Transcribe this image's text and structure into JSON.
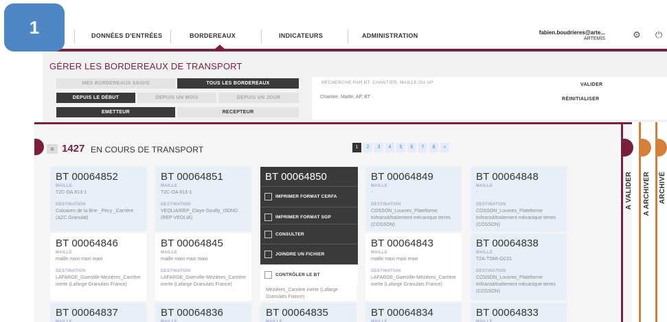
{
  "step_number": "1",
  "nav": {
    "items": [
      "DONNÉES D'ENTRÉES",
      "BORDEREAUX",
      "INDICATEURS",
      "ADMINISTRATION"
    ]
  },
  "user": {
    "name": "fabien.boudrieres@arte...",
    "org": "ARTEMIS"
  },
  "panel": {
    "title": "GÉRER LES BORDEREAUX DE TRANSPORT",
    "scope": [
      "MES BORDEREAUX SAISIS",
      "TOUS LES BORDEREAUX"
    ],
    "period": [
      "DEPUIS LE DÉBUT",
      "DEPUIS UN MOIS",
      "DEPUIS UN JOUR"
    ],
    "role": [
      "EMETTEUR",
      "RECEPTEUR"
    ],
    "search_label": "RECHERCHE PAR BT, CHANTIER, MAILLE OU AP",
    "search_placeholder": "Chantier, Maille, AP, BT",
    "validate": "VALIDER",
    "reset": "RÉINITIALISER"
  },
  "list": {
    "count": "1427",
    "label": "EN COURS DE TRANSPORT",
    "pages": [
      "1",
      "2",
      "3",
      "4",
      "5",
      "6",
      "7",
      "8",
      "»"
    ]
  },
  "labels": {
    "maille": "MAILLE",
    "destination": "DESTINATION"
  },
  "cards": [
    {
      "id": "BT 00064852",
      "maille": "T2C-OA 813-1",
      "dest": "Calcaires de la Brie _Pécy _Carrière (AZC Granulat)"
    },
    {
      "id": "BT 00064851",
      "maille": "T2C-OA 813-1",
      "dest": "VEOLIA/REP_Claye-Souilly_ISDND (REP VEOLIA)"
    },
    {
      "id": "BT 00064849",
      "maille": "-",
      "dest": "COSSON_Louvres_Plateforme tri/transit/traitement mécanique terres (COSSON)"
    },
    {
      "id": "BT 00064848",
      "maille": "-",
      "dest": "COSSON_Louvres_Plateforme tri/transit/traitement mécanique terres (COSSON)"
    },
    {
      "id": "BT 00064846",
      "maille": "maille maxi maxi maxi",
      "dest": "LAFARGE_Guerville-Mézières_Carrière inerte (Lafarge Granulats France)"
    },
    {
      "id": "BT 00064845",
      "maille": "maille maxi maxi maxi",
      "dest": "LAFARGE_Guerville-Mézières_Carrière inerte (Lafarge Granulats France)"
    },
    {
      "id": "BT 00064843",
      "maille": "maille maxi maxi maxi",
      "dest": "LAFARGE_Guerville-Mézières_Carrière inerte (Lafarge Granulats France)"
    },
    {
      "id": "BT 00064838",
      "maille": "T2A-TSMI-GC01",
      "dest": "COSSON_Louvres_Plateforme tri/transit/traitement mécanique terres (COSSON)"
    },
    {
      "id": "BT 00064837"
    },
    {
      "id": "BT 00064836"
    },
    {
      "id": "BT 00064835"
    },
    {
      "id": "BT 00064834"
    },
    {
      "id": "BT 00064833"
    }
  ],
  "middle_card": {
    "dest_partial": "Mézières_Carrière inerte (Lafarge Granulats France)"
  },
  "dropdown": {
    "title": "BT 00064850",
    "items": [
      "IMPRIMER FORMAT CERFA",
      "IMPRIMER FORMAT SGP",
      "CONSULTER",
      "JOINDRE UN FICHIER",
      "CONTRÔLER LE BT"
    ]
  },
  "right_tabs": [
    "A VALIDER",
    "A ARCHIVER",
    "ARCHIVÉ"
  ],
  "colors": {
    "brand": "#7a1f3a",
    "badge": "#4f86c6",
    "card_bg": "#e7f0f8",
    "tab_orange": "#d4803a"
  }
}
